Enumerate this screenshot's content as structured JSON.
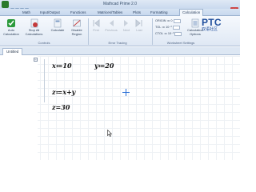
{
  "window": {
    "title": "Mathcad Prime 2.0",
    "minimize": "–",
    "maximize": "□",
    "close": "✕"
  },
  "ribbon_tabs": [
    "Math",
    "Input/Output",
    "Functions",
    "Matrices/Tables",
    "Plots",
    "Formatting",
    "Calculation"
  ],
  "controls": {
    "auto_calc": "Auto Calculation",
    "stop_all": "Stop All Calculations",
    "calculate": "Calculate",
    "disable_region": "Disable Region",
    "group_label": "Controls"
  },
  "error_tracing": {
    "first": "First",
    "previous": "Previous",
    "next": "Next",
    "last": "Last",
    "group_label": "Error Tracing"
  },
  "worksheet_settings": {
    "origin_label": "ORIGIN ≔",
    "origin_value": "0",
    "tol_label": "TOL ≔",
    "tol_value": "10⁻³",
    "ctol_label": "CTOL ≔",
    "ctol_value": "10⁻³",
    "calc_options": "Calculation Options",
    "group_label": "Worksheet Settings"
  },
  "logo": {
    "brand": "PTC",
    "subtitle": "双语社区"
  },
  "document_tab": "Untitled",
  "worksheet": {
    "collapse_glyph": "−",
    "eq_x": "x≔10",
    "eq_y": "y≔20",
    "eq_z": "z≔x+y",
    "eq_result": "z=30"
  },
  "colors": {
    "accent": "#1f4e9c",
    "auto_calc_icon": "#2b9a3c",
    "stop_icon": "#c43a3a"
  }
}
